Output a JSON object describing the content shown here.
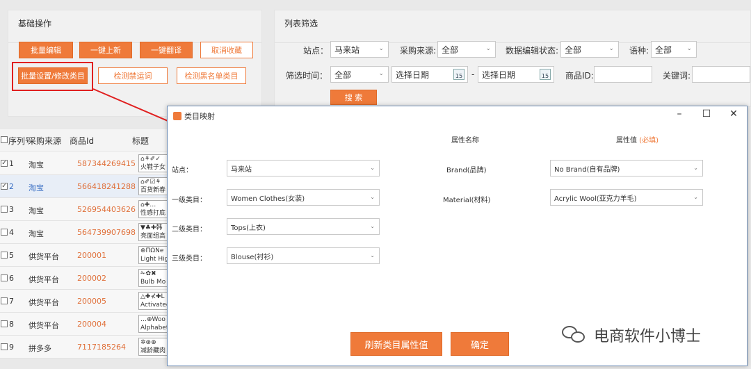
{
  "basic_ops": {
    "title": "基础操作",
    "buttons": {
      "batch_edit": "批量编辑",
      "one_click_list": "一键上新",
      "one_click_translate": "一键翻译",
      "cancel_favorite": "取消收藏",
      "batch_category": "批量设置/修改类目",
      "check_banned": "检测禁运词",
      "check_blacklist": "检测黑名单类目"
    }
  },
  "filter": {
    "title": "列表筛选",
    "site_label": "站点：",
    "site_value": "马来站",
    "source_label": "采购来源:",
    "source_value": "全部",
    "edit_status_label": "数据编辑状态:",
    "edit_status_value": "全部",
    "language_label": "语种:",
    "language_value": "全部",
    "time_label": "筛选时间：",
    "time_value": "全部",
    "start_date": "选择日期",
    "date_sep": "-",
    "end_date": "选择日期",
    "calendar_num": "15",
    "product_id_label": "商品ID:",
    "keyword_label": "关键词:",
    "search_button": "搜 索"
  },
  "table": {
    "headers": [
      "序列号",
      "采购来源",
      "商品Id",
      "标题"
    ],
    "rows": [
      {
        "checked": "✓",
        "no": "1",
        "source": "淘宝",
        "id": "587344269415",
        "title1": "⌂⚘✐✓",
        "title2": "火鞋子女"
      },
      {
        "checked": "✓",
        "no": "2",
        "source": "淘宝",
        "id": "566418241288",
        "title1": "⌂✐☑⚘",
        "title2": "百货新春"
      },
      {
        "checked": "",
        "no": "3",
        "source": "淘宝",
        "id": "526954403626",
        "title1": "⌂✚…",
        "title2": "性感打底"
      },
      {
        "checked": "",
        "no": "4",
        "source": "淘宝",
        "id": "564739907698",
        "title1": "▼♣✚韩",
        "title2": "亮面组高"
      },
      {
        "checked": "",
        "no": "5",
        "source": "供货平台",
        "id": "200001",
        "title1": "⊕ΠΩNe",
        "title2": "Light Hig"
      },
      {
        "checked": "",
        "no": "6",
        "source": "供货平台",
        "id": "200002",
        "title1": "✁✿✖",
        "title2": "Bulb Mo"
      },
      {
        "checked": "",
        "no": "7",
        "source": "供货平台",
        "id": "200005",
        "title1": "△✚⊀✚L",
        "title2": "Activated"
      },
      {
        "checked": "",
        "no": "8",
        "source": "供货平台",
        "id": "200004",
        "title1": "…⊕Woo",
        "title2": "Alphabet"
      },
      {
        "checked": "",
        "no": "9",
        "source": "拼多多",
        "id": "7117185264",
        "title1": "✲⊛⊕",
        "title2": "减龄藏肉"
      }
    ]
  },
  "dialog": {
    "title": "类目映射",
    "minimize": "–",
    "maximize": "☐",
    "close": "✕",
    "attr_name_header": "属性名称",
    "attr_value_header": "属性值",
    "required_note": "(必填)",
    "site_label": "站点：",
    "site_value": "马来站",
    "cat1_label": "一级类目：",
    "cat1_value": "Women Clothes(女装)",
    "cat2_label": "二级类目：",
    "cat2_value": "Tops(上衣)",
    "cat3_label": "三级类目：",
    "cat3_value": "Blouse(衬衫)",
    "attrs": [
      {
        "name": "Brand(品牌)",
        "value": "No Brand(自有品牌)"
      },
      {
        "name": "Material(材料)",
        "value": "Acrylic Wool(亚克力羊毛)"
      }
    ],
    "refresh_button": "刷新类目属性值",
    "confirm_button": "确定"
  },
  "watermark": "电商软件小博士",
  "colors": {
    "accent": "#ef7a3a",
    "highlight": "#e02020",
    "link_orange": "#e0703a",
    "link_blue": "#3a6fc4"
  }
}
